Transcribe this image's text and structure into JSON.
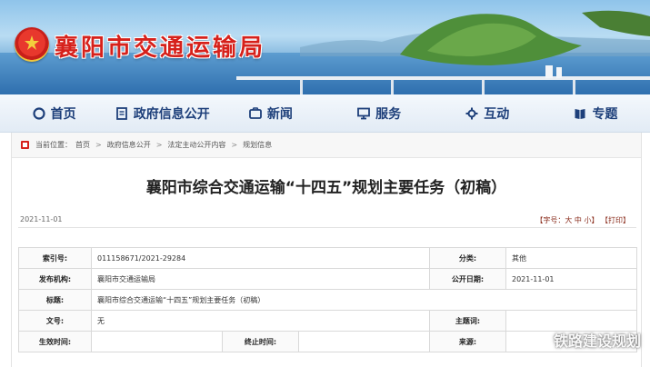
{
  "site": {
    "title": "襄阳市交通运输局"
  },
  "nav": {
    "items": [
      {
        "label": "首页",
        "icon": "home-icon"
      },
      {
        "label": "政府信息公开",
        "icon": "document-icon"
      },
      {
        "label": "新闻",
        "icon": "news-icon"
      },
      {
        "label": "服务",
        "icon": "monitor-icon"
      },
      {
        "label": "互动",
        "icon": "gear-icon"
      },
      {
        "label": "专题",
        "icon": "book-icon"
      }
    ]
  },
  "breadcrumb": {
    "prefix": "当前位置：",
    "items": [
      "首页",
      "政府信息公开",
      "法定主动公开内容",
      "规划信息"
    ],
    "separator": ">"
  },
  "article": {
    "title": "襄阳市综合交通运输“十四五”规划主要任务（初稿）",
    "date": "2021-11-01",
    "font_size_label": "【字号：",
    "font_large": "大",
    "font_medium": "中",
    "font_small": "小",
    "font_close": "】",
    "print_label": "【打印】"
  },
  "info_table": {
    "index_label": "索引号:",
    "index_value": "011158671/2021-29284",
    "category_label": "分类:",
    "category_value": "其他",
    "publisher_label": "发布机构:",
    "publisher_value": "襄阳市交通运输局",
    "pubdate_label": "公开日期:",
    "pubdate_value": "2021-11-01",
    "title_label": "标题:",
    "title_value": "襄阳市综合交通运输“十四五”规划主要任务（初稿）",
    "docno_label": "文号:",
    "docno_value": "无",
    "subject_label": "主题词:",
    "subject_value": "",
    "effective_label": "生效时间:",
    "effective_value": "",
    "expiry_label": "终止时间:",
    "expiry_value": "",
    "source_label": "来源:",
    "source_value": ""
  },
  "watermark": {
    "text": "铁路建设规划"
  },
  "colors": {
    "brand_red": "#d6211b",
    "nav_text": "#1d3f7a"
  }
}
